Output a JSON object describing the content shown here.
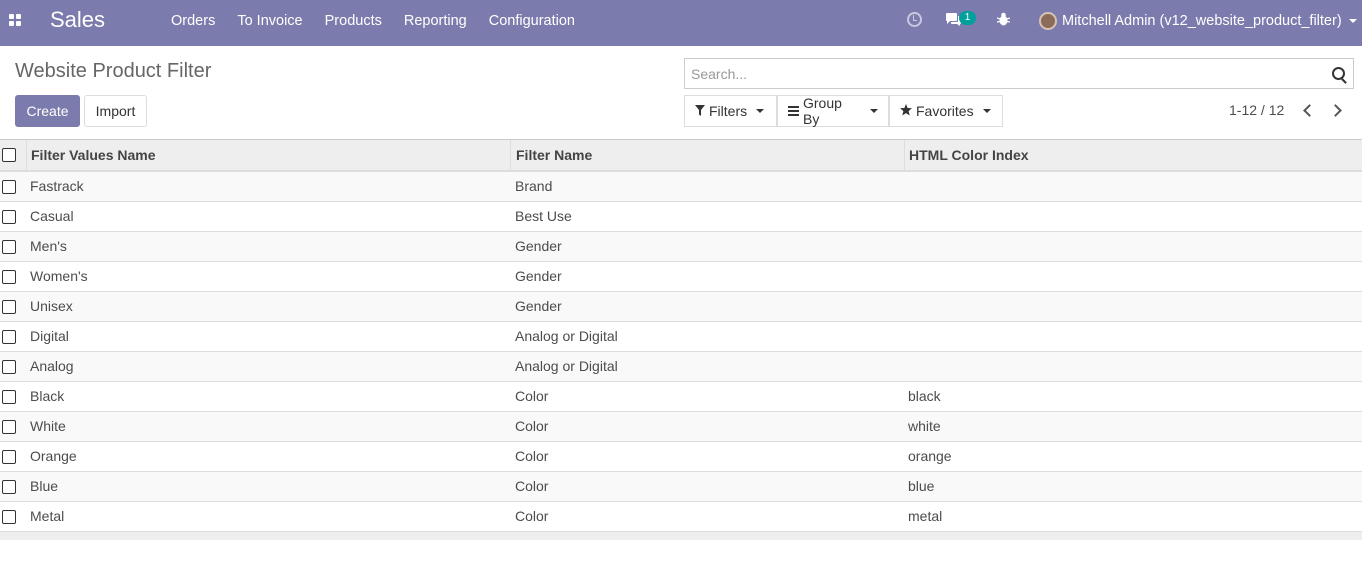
{
  "navbar": {
    "app_name": "Sales",
    "menu": [
      "Orders",
      "To Invoice",
      "Products",
      "Reporting",
      "Configuration"
    ],
    "chat_badge": "1",
    "user_name": "Mitchell Admin (v12_website_product_filter)"
  },
  "control_panel": {
    "title": "Website Product Filter",
    "create_label": "Create",
    "import_label": "Import",
    "search_placeholder": "Search...",
    "filters_label": "Filters",
    "groupby_label": "Group By",
    "favorites_label": "Favorites",
    "pager": "1-12 / 12"
  },
  "table": {
    "headers": [
      "Filter Values Name",
      "Filter Name",
      "HTML Color Index"
    ],
    "rows": [
      [
        "Fastrack",
        "Brand",
        ""
      ],
      [
        "Casual",
        "Best Use",
        ""
      ],
      [
        "Men's",
        "Gender",
        ""
      ],
      [
        "Women's",
        "Gender",
        ""
      ],
      [
        "Unisex",
        "Gender",
        ""
      ],
      [
        "Digital",
        "Analog or Digital",
        ""
      ],
      [
        "Analog",
        "Analog or Digital",
        ""
      ],
      [
        "Black",
        "Color",
        "black"
      ],
      [
        "White",
        "Color",
        "white"
      ],
      [
        "Orange",
        "Color",
        "orange"
      ],
      [
        "Blue",
        "Color",
        "blue"
      ],
      [
        "Metal",
        "Color",
        "metal"
      ]
    ]
  },
  "colors": {
    "brand": "#7c7bad",
    "badge": "#00a09d"
  }
}
